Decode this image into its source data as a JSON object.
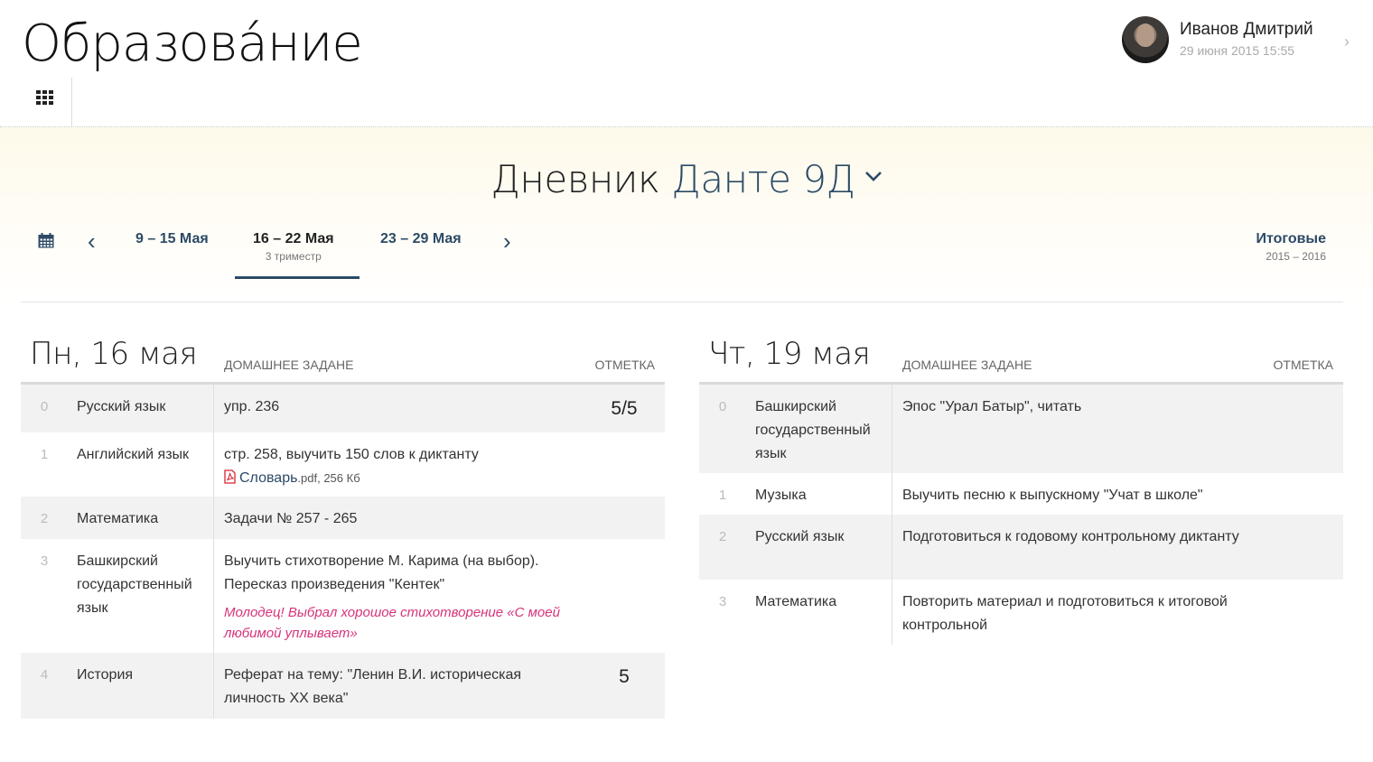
{
  "app": {
    "title": "Образова́ние"
  },
  "user": {
    "name": "Иванов Дмитрий",
    "datetime": "29 июня 2015 15:55"
  },
  "diary": {
    "title_prefix": "Дневник",
    "title_accent": "Данте 9Д"
  },
  "weeks": {
    "prev": {
      "label": "9 – 15 Мая"
    },
    "current": {
      "label": "16 – 22 Мая",
      "sub": "3 триместр"
    },
    "next": {
      "label": "23 – 29 Мая"
    }
  },
  "totals": {
    "label": "Итоговые",
    "sub": "2015 – 2016"
  },
  "days": [
    {
      "title": "Пн, 16 мая",
      "col_hw": "ДОМАШНЕЕ ЗАДАНЕ",
      "col_mark": "ОТМЕТКА",
      "lessons": [
        {
          "num": "0",
          "subject": "Русский язык",
          "homework": "упр. 236",
          "mark": "5/5"
        },
        {
          "num": "1",
          "subject": "Английский язык",
          "homework": "стр. 258, выучить 150 слов к диктанту",
          "attachment_name": "Словарь",
          "attachment_meta": ".pdf, 256 Кб",
          "mark": ""
        },
        {
          "num": "2",
          "subject": "Математика",
          "homework": "Задачи № 257 - 265",
          "mark": ""
        },
        {
          "num": "3",
          "subject": "Башкирский государственный язык",
          "homework": "Выучить стихотворение М. Карима (на выбор). Пересказ произведения \"Кентек\"",
          "comment": "Молодец! Выбрал хорошое стихотворение «С моей любимой уплывает»",
          "mark": ""
        },
        {
          "num": "4",
          "subject": "История",
          "homework": "Реферат на тему: \"Ленин В.И. историческая личность XX века\"",
          "mark": "5"
        }
      ]
    },
    {
      "title": "Чт, 19 мая",
      "col_hw": "ДОМАШНЕЕ ЗАДАНЕ",
      "col_mark": "ОТМЕТКА",
      "lessons": [
        {
          "num": "0",
          "subject": "Башкирский государственный язык",
          "homework": "Эпос \"Урал Батыр\", читать",
          "mark": ""
        },
        {
          "num": "1",
          "subject": "Музыка",
          "homework": "Выучить песню к выпускному \"Учат в школе\"",
          "mark": ""
        },
        {
          "num": "2",
          "subject": "Русский язык",
          "homework": "Подготовиться к годовому контрольному диктанту",
          "mark": ""
        },
        {
          "num": "3",
          "subject": "Математика",
          "homework": "Повторить материал и подготовиться к итоговой контрольной",
          "mark": ""
        }
      ]
    }
  ],
  "icons": {
    "apps": "grid-icon",
    "calendar": "calendar-icon",
    "pdf": "pdf-icon",
    "user_chevron": "chevron-right-icon",
    "diary_chevron": "chevron-down-icon"
  },
  "colors": {
    "accent": "#2c4a66",
    "comment": "#d6337a",
    "band": "#fdf9ea",
    "row_alt": "#f2f2f2"
  }
}
